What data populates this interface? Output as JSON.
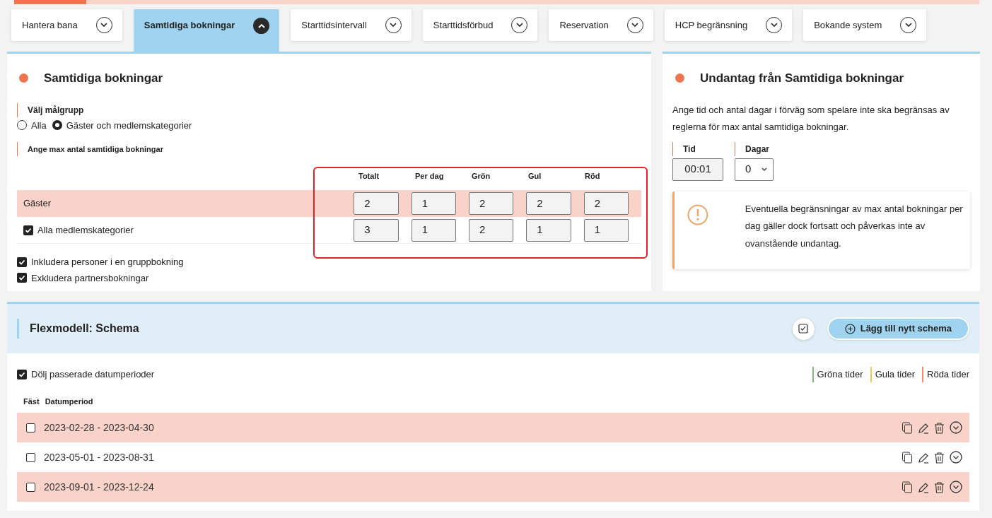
{
  "progress": {
    "level": 0.075
  },
  "tabs": [
    {
      "label": "Hantera bana",
      "selected": false
    },
    {
      "label": "Samtidiga bokningar",
      "selected": true
    },
    {
      "label": "Starttidsintervall",
      "selected": false
    },
    {
      "label": "Starttidsförbud",
      "selected": false
    },
    {
      "label": "Reservation",
      "selected": false
    },
    {
      "label": "HCP begränsning",
      "selected": false
    },
    {
      "label": "Bokande system",
      "selected": false
    }
  ],
  "main_panel": {
    "title": "Samtidiga bokningar",
    "target_label": "Välj målgrupp",
    "target_options": [
      {
        "label": "Alla",
        "selected": false
      },
      {
        "label": "Gäster och medlemskategorier",
        "selected": true
      }
    ],
    "max_label": "Ange max antal samtidiga bokningar",
    "columns": [
      "Totalt",
      "Per dag",
      "Grön",
      "Gul",
      "Röd"
    ],
    "rows": [
      {
        "kind": "plain",
        "label": "Gäster",
        "values": [
          "2",
          "1",
          "2",
          "2",
          "2"
        ]
      },
      {
        "kind": "checkbox",
        "label": "Alla medlemskategorier",
        "checked": true,
        "values": [
          "3",
          "1",
          "2",
          "1",
          "1"
        ]
      }
    ],
    "options": [
      {
        "label": "Inkludera personer i en gruppbokning",
        "checked": true
      },
      {
        "label": "Exkludera partnersbokningar",
        "checked": true
      }
    ]
  },
  "exception_panel": {
    "title": "Undantag från Samtidiga bokningar",
    "description": "Ange tid och antal dagar i förväg som spelare inte ska begränsas av reglerna för max antal samtidiga bokningar.",
    "time_label": "Tid",
    "time_value": "00:01",
    "days_label": "Dagar",
    "days_value": "0",
    "notice": "Eventuella begränsningar av max antal bokningar per dag gäller dock fortsatt och påverkas inte av ovanstående undantag."
  },
  "schedule": {
    "title": "Flexmodell: Schema",
    "add_button": "Lägg till nytt schema",
    "hide_past": {
      "label": "Dölj passerade datumperioder",
      "checked": true
    },
    "legend": [
      {
        "label": "Gröna tider",
        "color": "#7fba7a"
      },
      {
        "label": "Gula tider",
        "color": "#f2c94c"
      },
      {
        "label": "Röda tider",
        "color": "#f0906f"
      }
    ],
    "columns": [
      "Fäst",
      "Datumperiod"
    ],
    "rows": [
      {
        "period": "2023-02-28 - 2023-04-30",
        "pinned": false
      },
      {
        "period": "2023-05-01 - 2023-08-31",
        "pinned": false
      },
      {
        "period": "2023-09-01 - 2023-12-24",
        "pinned": false
      }
    ]
  }
}
